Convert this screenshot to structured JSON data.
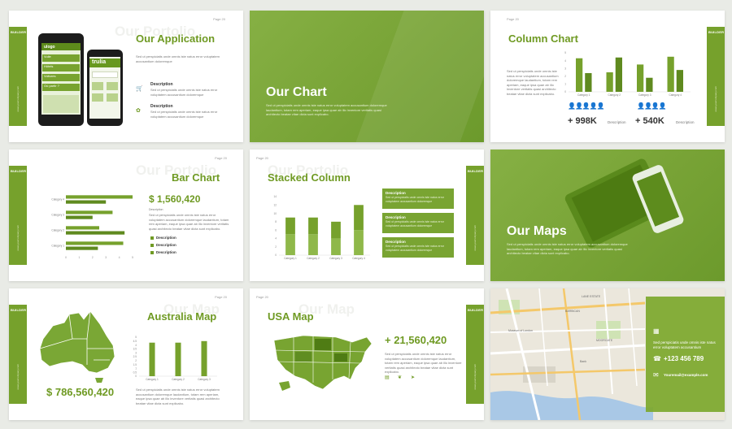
{
  "brand": "BUILDER",
  "side_text": "www.yourcompany.com",
  "lorem_long": "Sed ut perspiciatis unde omnis iste natus error voluptatem accusantium doloremque laudantium, totam rem aperiam, eaque ipsa quae ab illo inventore veritatis quasi architecto beatae vitae dicta sunt explicabo.",
  "lorem_short": "Sed ut perspiciatis unde omnis iste natus error voluptatem accusantium doloremque",
  "slides": {
    "app": {
      "page": "Page 20",
      "ghost": "Our Portolio",
      "title": "Our Application",
      "desc1": "Description",
      "desc2": "Description",
      "phone_big": {
        "brand": "ulogo",
        "m1": "Vuile",
        "m2": "Hôtels",
        "m3": "Voitures",
        "m4": "Où partir ?"
      },
      "phone_small": {
        "brand": "trulia"
      }
    },
    "our_chart": {
      "title": "Our Chart"
    },
    "column_chart": {
      "page": "Page 20",
      "title": "Column Chart",
      "stat1": "+ 998K",
      "stat2": "+ 540K",
      "stat_label": "Description"
    },
    "bar_chart": {
      "page": "Page 20",
      "ghost": "Our Portolio",
      "title": "Bar Chart",
      "amount": "$ 1,560,420",
      "desc": "Description",
      "legend": [
        "Description",
        "Description",
        "Description"
      ]
    },
    "stacked": {
      "page": "Page 20",
      "ghost": "Our Portolio",
      "title": "Stacked Column",
      "box_title": "Description"
    },
    "our_maps": {
      "title": "Our Maps"
    },
    "australia": {
      "page": "Page 20",
      "ghost": "Our Map",
      "title": "Australia Map",
      "amount": "$ 786,560,420"
    },
    "usa": {
      "page": "Page 20",
      "ghost": "Our Map",
      "title": "USA Map",
      "amount": "+ 21,560,420"
    },
    "city_map": {
      "address": "Sed perspiciatis unde omnis iste natus error voluptatem accusantium",
      "phone": "+123 456 789",
      "email": "Youremail@example.com",
      "labels": [
        "LANE ESTATE",
        "BARBICAN",
        "Museum of London",
        "MOORGATE",
        "Bank"
      ]
    }
  },
  "chart_data": [
    {
      "type": "bar",
      "categories": [
        "Category 1",
        "Category 2",
        "Category 3",
        "Category 4"
      ],
      "series": [
        {
          "values": [
            4.3,
            2.5,
            3.5,
            4.5
          ]
        },
        {
          "values": [
            2.4,
            4.4,
            1.8,
            2.8
          ]
        }
      ],
      "yticks": [
        "0",
        "1",
        "2",
        "3",
        "4",
        "5"
      ],
      "ylim": [
        0,
        5
      ]
    },
    {
      "type": "bar",
      "orientation": "horizontal",
      "categories": [
        "Category 4",
        "Category 3",
        "Category 2",
        "Category 1"
      ],
      "series": [
        {
          "values": [
            5,
            3.5,
            2.5,
            4.3
          ]
        },
        {
          "values": [
            3,
            2,
            4.4,
            2.4
          ]
        }
      ],
      "xticks": [
        "0",
        "1",
        "2",
        "3",
        "4",
        "5"
      ],
      "xlim": [
        0,
        5
      ]
    },
    {
      "type": "bar",
      "stacked": true,
      "categories": [
        "Category 1",
        "Category 2",
        "Category 3",
        "Category 4"
      ],
      "series": [
        {
          "values": [
            5,
            5,
            4,
            6
          ]
        },
        {
          "values": [
            4,
            4,
            4,
            6
          ]
        }
      ],
      "yticks": [
        "0",
        "2",
        "4",
        "6",
        "8",
        "10",
        "12",
        "14"
      ],
      "ylim": [
        0,
        14
      ]
    },
    {
      "type": "bar",
      "categories": [
        "Category 1",
        "Category 2",
        "Category 3"
      ],
      "series": [
        {
          "values": [
            4.3,
            4.3,
            4.5
          ]
        }
      ],
      "yticks": [
        "0",
        "0.5",
        "1",
        "1.5",
        "2",
        "2.5",
        "3",
        "3.5",
        "4",
        "4.5",
        "5"
      ],
      "ylim": [
        0,
        5
      ]
    }
  ],
  "colors": {
    "green": "#76a12c",
    "green_dark": "#5f8a1f",
    "green_light": "#8fb84a"
  }
}
